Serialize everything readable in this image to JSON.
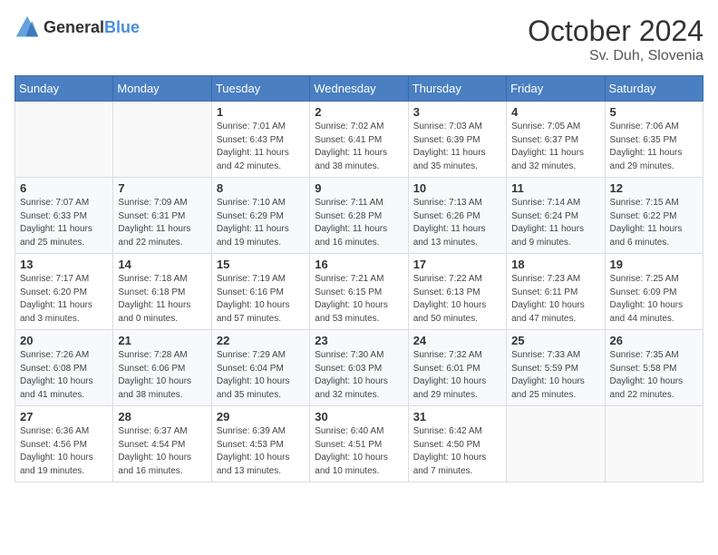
{
  "header": {
    "logo_general": "General",
    "logo_blue": "Blue",
    "month": "October 2024",
    "location": "Sv. Duh, Slovenia"
  },
  "weekdays": [
    "Sunday",
    "Monday",
    "Tuesday",
    "Wednesday",
    "Thursday",
    "Friday",
    "Saturday"
  ],
  "weeks": [
    [
      {
        "day": "",
        "info": ""
      },
      {
        "day": "",
        "info": ""
      },
      {
        "day": "1",
        "info": "Sunrise: 7:01 AM\nSunset: 6:43 PM\nDaylight: 11 hours and 42 minutes."
      },
      {
        "day": "2",
        "info": "Sunrise: 7:02 AM\nSunset: 6:41 PM\nDaylight: 11 hours and 38 minutes."
      },
      {
        "day": "3",
        "info": "Sunrise: 7:03 AM\nSunset: 6:39 PM\nDaylight: 11 hours and 35 minutes."
      },
      {
        "day": "4",
        "info": "Sunrise: 7:05 AM\nSunset: 6:37 PM\nDaylight: 11 hours and 32 minutes."
      },
      {
        "day": "5",
        "info": "Sunrise: 7:06 AM\nSunset: 6:35 PM\nDaylight: 11 hours and 29 minutes."
      }
    ],
    [
      {
        "day": "6",
        "info": "Sunrise: 7:07 AM\nSunset: 6:33 PM\nDaylight: 11 hours and 25 minutes."
      },
      {
        "day": "7",
        "info": "Sunrise: 7:09 AM\nSunset: 6:31 PM\nDaylight: 11 hours and 22 minutes."
      },
      {
        "day": "8",
        "info": "Sunrise: 7:10 AM\nSunset: 6:29 PM\nDaylight: 11 hours and 19 minutes."
      },
      {
        "day": "9",
        "info": "Sunrise: 7:11 AM\nSunset: 6:28 PM\nDaylight: 11 hours and 16 minutes."
      },
      {
        "day": "10",
        "info": "Sunrise: 7:13 AM\nSunset: 6:26 PM\nDaylight: 11 hours and 13 minutes."
      },
      {
        "day": "11",
        "info": "Sunrise: 7:14 AM\nSunset: 6:24 PM\nDaylight: 11 hours and 9 minutes."
      },
      {
        "day": "12",
        "info": "Sunrise: 7:15 AM\nSunset: 6:22 PM\nDaylight: 11 hours and 6 minutes."
      }
    ],
    [
      {
        "day": "13",
        "info": "Sunrise: 7:17 AM\nSunset: 6:20 PM\nDaylight: 11 hours and 3 minutes."
      },
      {
        "day": "14",
        "info": "Sunrise: 7:18 AM\nSunset: 6:18 PM\nDaylight: 11 hours and 0 minutes."
      },
      {
        "day": "15",
        "info": "Sunrise: 7:19 AM\nSunset: 6:16 PM\nDaylight: 10 hours and 57 minutes."
      },
      {
        "day": "16",
        "info": "Sunrise: 7:21 AM\nSunset: 6:15 PM\nDaylight: 10 hours and 53 minutes."
      },
      {
        "day": "17",
        "info": "Sunrise: 7:22 AM\nSunset: 6:13 PM\nDaylight: 10 hours and 50 minutes."
      },
      {
        "day": "18",
        "info": "Sunrise: 7:23 AM\nSunset: 6:11 PM\nDaylight: 10 hours and 47 minutes."
      },
      {
        "day": "19",
        "info": "Sunrise: 7:25 AM\nSunset: 6:09 PM\nDaylight: 10 hours and 44 minutes."
      }
    ],
    [
      {
        "day": "20",
        "info": "Sunrise: 7:26 AM\nSunset: 6:08 PM\nDaylight: 10 hours and 41 minutes."
      },
      {
        "day": "21",
        "info": "Sunrise: 7:28 AM\nSunset: 6:06 PM\nDaylight: 10 hours and 38 minutes."
      },
      {
        "day": "22",
        "info": "Sunrise: 7:29 AM\nSunset: 6:04 PM\nDaylight: 10 hours and 35 minutes."
      },
      {
        "day": "23",
        "info": "Sunrise: 7:30 AM\nSunset: 6:03 PM\nDaylight: 10 hours and 32 minutes."
      },
      {
        "day": "24",
        "info": "Sunrise: 7:32 AM\nSunset: 6:01 PM\nDaylight: 10 hours and 29 minutes."
      },
      {
        "day": "25",
        "info": "Sunrise: 7:33 AM\nSunset: 5:59 PM\nDaylight: 10 hours and 25 minutes."
      },
      {
        "day": "26",
        "info": "Sunrise: 7:35 AM\nSunset: 5:58 PM\nDaylight: 10 hours and 22 minutes."
      }
    ],
    [
      {
        "day": "27",
        "info": "Sunrise: 6:36 AM\nSunset: 4:56 PM\nDaylight: 10 hours and 19 minutes."
      },
      {
        "day": "28",
        "info": "Sunrise: 6:37 AM\nSunset: 4:54 PM\nDaylight: 10 hours and 16 minutes."
      },
      {
        "day": "29",
        "info": "Sunrise: 6:39 AM\nSunset: 4:53 PM\nDaylight: 10 hours and 13 minutes."
      },
      {
        "day": "30",
        "info": "Sunrise: 6:40 AM\nSunset: 4:51 PM\nDaylight: 10 hours and 10 minutes."
      },
      {
        "day": "31",
        "info": "Sunrise: 6:42 AM\nSunset: 4:50 PM\nDaylight: 10 hours and 7 minutes."
      },
      {
        "day": "",
        "info": ""
      },
      {
        "day": "",
        "info": ""
      }
    ]
  ]
}
